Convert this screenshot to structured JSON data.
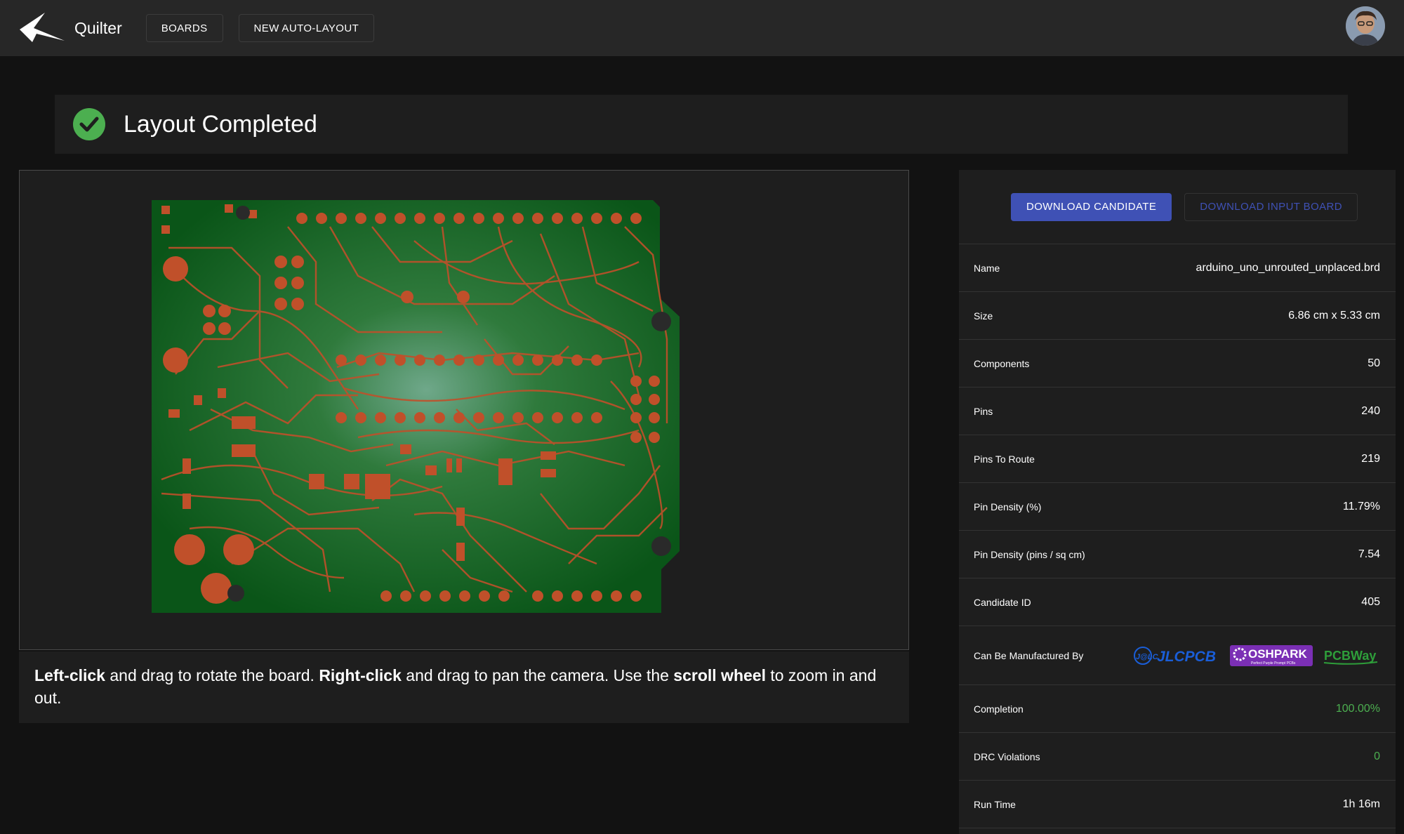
{
  "header": {
    "brand": "Quilter",
    "nav": [
      "BOARDS",
      "NEW AUTO-LAYOUT"
    ]
  },
  "status": {
    "title": "Layout Completed",
    "color": "#4caf50"
  },
  "viewer": {
    "instructions": {
      "p1": "Left-click",
      "t1": " and drag to rotate the board. ",
      "p2": "Right-click",
      "t2": " and drag to pan the camera. Use the ",
      "p3": "scroll wheel",
      "t3": " to zoom in and out."
    }
  },
  "actions": {
    "download_candidate": "DOWNLOAD CANDIDATE",
    "download_input": "DOWNLOAD INPUT BOARD"
  },
  "details": [
    {
      "label": "Name",
      "value": "arduino_uno_unrouted_unplaced.brd"
    },
    {
      "label": "Size",
      "value": "6.86 cm x 5.33 cm"
    },
    {
      "label": "Components",
      "value": "50"
    },
    {
      "label": "Pins",
      "value": "240"
    },
    {
      "label": "Pins To Route",
      "value": "219"
    },
    {
      "label": "Pin Density (%)",
      "value": "11.79%"
    },
    {
      "label": "Pin Density (pins / sq cm)",
      "value": "7.54"
    },
    {
      "label": "Candidate ID",
      "value": "405"
    }
  ],
  "manufacturers": {
    "label": "Can Be Manufactured By",
    "names": [
      "JLCPCB",
      "OSHPARK",
      "PCBWay"
    ],
    "oshpark_tagline": "Perfect Purple Prompt PCBs"
  },
  "results": [
    {
      "label": "Completion",
      "value": "100.00%"
    },
    {
      "label": "DRC Violations",
      "value": "0"
    },
    {
      "label": "Run Time",
      "value": "1h 16m"
    }
  ],
  "colors": {
    "accent": "#3f51b5",
    "success": "#4caf50",
    "board": "#0e5a1c",
    "copper": "#c0502a",
    "oshpark": "#7b2fb5",
    "pcbway": "#2e9e3a",
    "jlcpcb": "#1a5ed8"
  }
}
